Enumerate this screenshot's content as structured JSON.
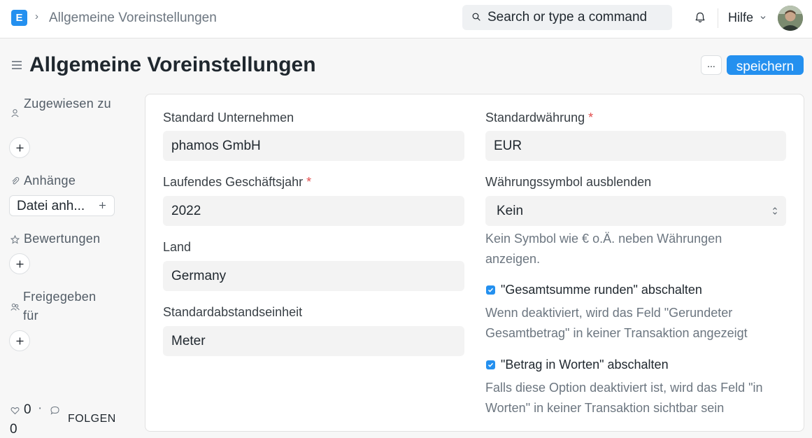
{
  "navbar": {
    "logo_letter": "E",
    "breadcrumb": "Allgemeine Voreinstellungen",
    "search_placeholder": "Search or type a command",
    "help_label": "Hilfe"
  },
  "page": {
    "title": "Allgemeine Voreinstellungen",
    "more_label": "...",
    "save_label": "speichern"
  },
  "sidebar": {
    "assigned_label": "Zugewiesen zu",
    "attachments_label": "Anhänge",
    "attach_button_label": "Datei anh...",
    "ratings_label": "Bewertungen",
    "shared_label": "Freigegeben für",
    "likes_count": "0",
    "comments_count": "0",
    "follow_label": "FOLGEN"
  },
  "form": {
    "company_label": "Standard Unternehmen",
    "company_value": "phamos GmbH",
    "fiscal_year_label": "Laufendes Geschäftsjahr",
    "fiscal_year_value": "2022",
    "country_label": "Land",
    "country_value": "Germany",
    "distance_unit_label": "Standardabstandseinheit",
    "distance_unit_value": "Meter",
    "currency_label": "Standardwährung",
    "currency_value": "EUR",
    "hide_symbol_label": "Währungssymbol ausblenden",
    "hide_symbol_value": "Kein",
    "hide_symbol_desc_1": "Kein Symbol wie € o.Ä. neben Währungen",
    "hide_symbol_desc_2": "anzeigen.",
    "rounded_total_label": "\"Gesamtsumme runden\" abschalten",
    "rounded_total_checked": true,
    "rounded_total_desc_1": "Wenn deaktiviert, wird das Feld \"Gerundeter",
    "rounded_total_desc_2": "Gesamtbetrag\" in keiner Transaktion angezeigt",
    "in_words_label": "\"Betrag in Worten\" abschalten",
    "in_words_checked": true,
    "in_words_desc_1": "Falls diese Option deaktiviert ist, wird das Feld \"in",
    "in_words_desc_2": "Worten\" in keiner Transaktion sichtbar sein",
    "required_mark": "*"
  },
  "colors": {
    "primary": "#2490ef",
    "required": "#e24c4c",
    "field_bg": "#f3f3f3"
  },
  "icons": [
    "app-logo",
    "chevron-right-icon",
    "search-icon",
    "bell-icon",
    "chevron-down-icon",
    "hamburger-icon",
    "user-icon",
    "plus-icon",
    "paperclip-icon",
    "star-icon",
    "share-users-icon",
    "heart-icon",
    "comment-icon",
    "select-arrows-icon",
    "checkmark-icon"
  ]
}
